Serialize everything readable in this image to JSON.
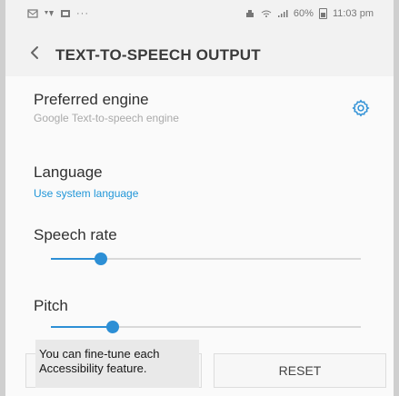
{
  "status_bar": {
    "left_icons": [
      "message-icon",
      "signal-icon",
      "image-icon"
    ],
    "more_text": "···",
    "right_text": "60% ⁠⁠⁠11:03 pm",
    "battery_percent": "60%",
    "time": "11:03 pm",
    "battery_color": "#777777"
  },
  "header": {
    "back_icon": "chevron-left-icon",
    "title": "TEXT-TO-SPEECH OUTPUT"
  },
  "rows": {
    "preferred_engine": {
      "title": "Preferred engine",
      "subtitle": "Google Text-to-speech engine",
      "icon": "gear-icon"
    },
    "language": {
      "title": "Language",
      "subtitle": "Use system language"
    },
    "speech_rate": {
      "title": "Speech rate",
      "value_fraction": 0.16
    },
    "pitch": {
      "title": "Pitch",
      "value_fraction": 0.2
    }
  },
  "tooltip": {
    "text": "You can fine-tune each Accessibility feature."
  },
  "bottom": {
    "reset_label": "RESET"
  },
  "colors": {
    "accent": "#2d8fd5",
    "link": "#2196d8",
    "background": "#f2f2f2",
    "text": "#303030",
    "muted_text": "#aaaaaa"
  }
}
